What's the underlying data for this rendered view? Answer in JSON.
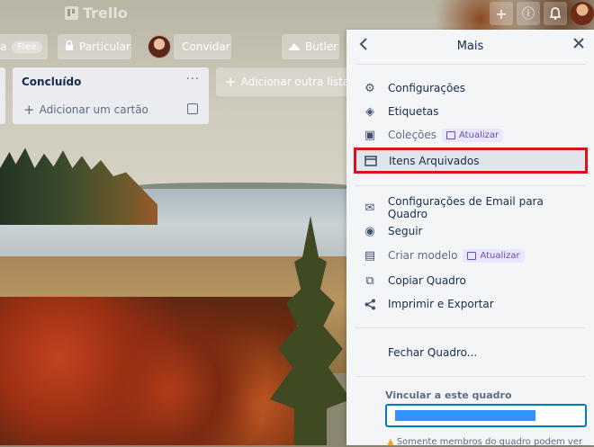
{
  "app": {
    "name": "Trello"
  },
  "topbar": {
    "icons": [
      "plus-icon",
      "info-icon",
      "bell-icon"
    ],
    "plus_glyph": "+",
    "info_glyph": "ⓘ",
    "bell_glyph": "🔔"
  },
  "board": {
    "name_fragment": "a",
    "free_badge": "Free",
    "visibility": "Particular",
    "invite": "Convidar",
    "butler": "Butler"
  },
  "list": {
    "title": "Concluído",
    "menu": "···",
    "add_card": "Adicionar um cartão"
  },
  "add_list": "Adicionar outra lista",
  "panel": {
    "title": "Mais",
    "back_glyph": "‹",
    "close_glyph": "✕",
    "items": [
      {
        "label": "Configurações",
        "icon": "gear-icon",
        "glyph": "⚙"
      },
      {
        "label": "Etiquetas",
        "icon": "tag-icon",
        "glyph": "◈"
      },
      {
        "label": "Coleções",
        "icon": "collection-icon",
        "glyph": "▣",
        "badge": "Atualizar"
      },
      {
        "label": "Itens Arquivados",
        "icon": "archive-icon",
        "glyph": "▭"
      },
      {
        "label": "Configurações de Email para Quadro",
        "icon": "email-icon",
        "glyph": "✉"
      },
      {
        "label": "Seguir",
        "icon": "eye-icon",
        "glyph": "◉"
      },
      {
        "label": "Criar modelo",
        "icon": "template-icon",
        "glyph": "▤",
        "badge": "Atualizar"
      },
      {
        "label": "Copiar Quadro",
        "icon": "copy-icon",
        "glyph": "⧉"
      },
      {
        "label": "Imprimir e Exportar",
        "icon": "share-icon",
        "glyph": "⋖"
      },
      {
        "label": "Fechar Quadro...",
        "icon": "",
        "glyph": ""
      }
    ],
    "link_label": "Vincular a este quadro",
    "note": "Somente membros do quadro podem ver"
  },
  "colors": {
    "highlight": "#d8141b",
    "accent": "#0079bf",
    "upgrade_bg": "#eae6ff"
  }
}
